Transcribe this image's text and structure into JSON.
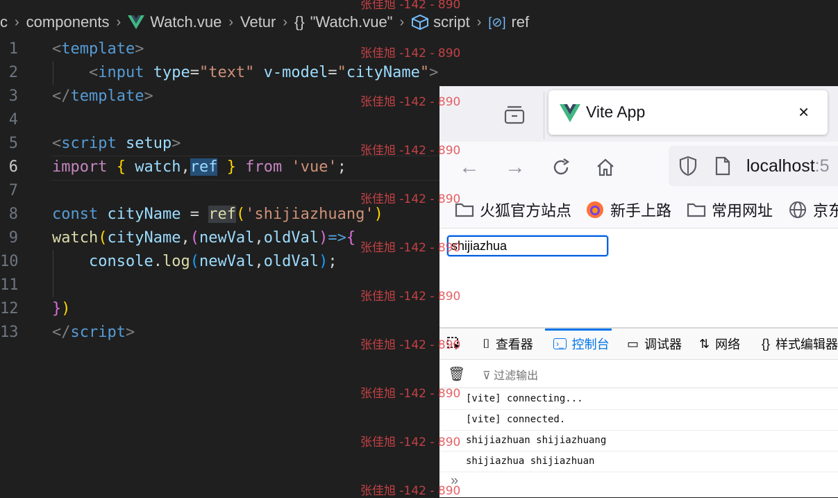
{
  "breadcrumb": {
    "prefix": "c",
    "folder": "components",
    "file": "Watch.vue",
    "tool": "Vetur",
    "obj": "\"Watch.vue\"",
    "obj_icon": "{}",
    "section": "script",
    "symbol": "ref"
  },
  "editor": {
    "line_numbers": [
      "1",
      "2",
      "3",
      "4",
      "5",
      "6",
      "7",
      "8",
      "9",
      "10",
      "11",
      "12",
      "13"
    ],
    "current_line": "6"
  },
  "watermark": "张佳旭 -142 - 890",
  "browser": {
    "tab_title": "Vite App",
    "tab_close": "×",
    "url_host": "localhost",
    "url_port": ":5",
    "bookmarks": [
      "火狐官方站点",
      "新手上路",
      "常用网址",
      "京东"
    ],
    "input_value": "shijiazhua"
  },
  "devtools": {
    "tabs": [
      "查看器",
      "控制台",
      "调试器",
      "网络",
      "样式编辑器"
    ],
    "active_tab": "控制台",
    "filter_placeholder": "过滤输出",
    "logs": [
      "[vite] connecting...",
      "[vite] connected.",
      "shijiazhuan shijiazhuang",
      "shijiazhua shijiazhuan"
    ],
    "prompt": "»"
  },
  "colors": {
    "editor_bg": "#1f1f1f",
    "accent": "#0074e8",
    "watermark": "#e0474c"
  }
}
